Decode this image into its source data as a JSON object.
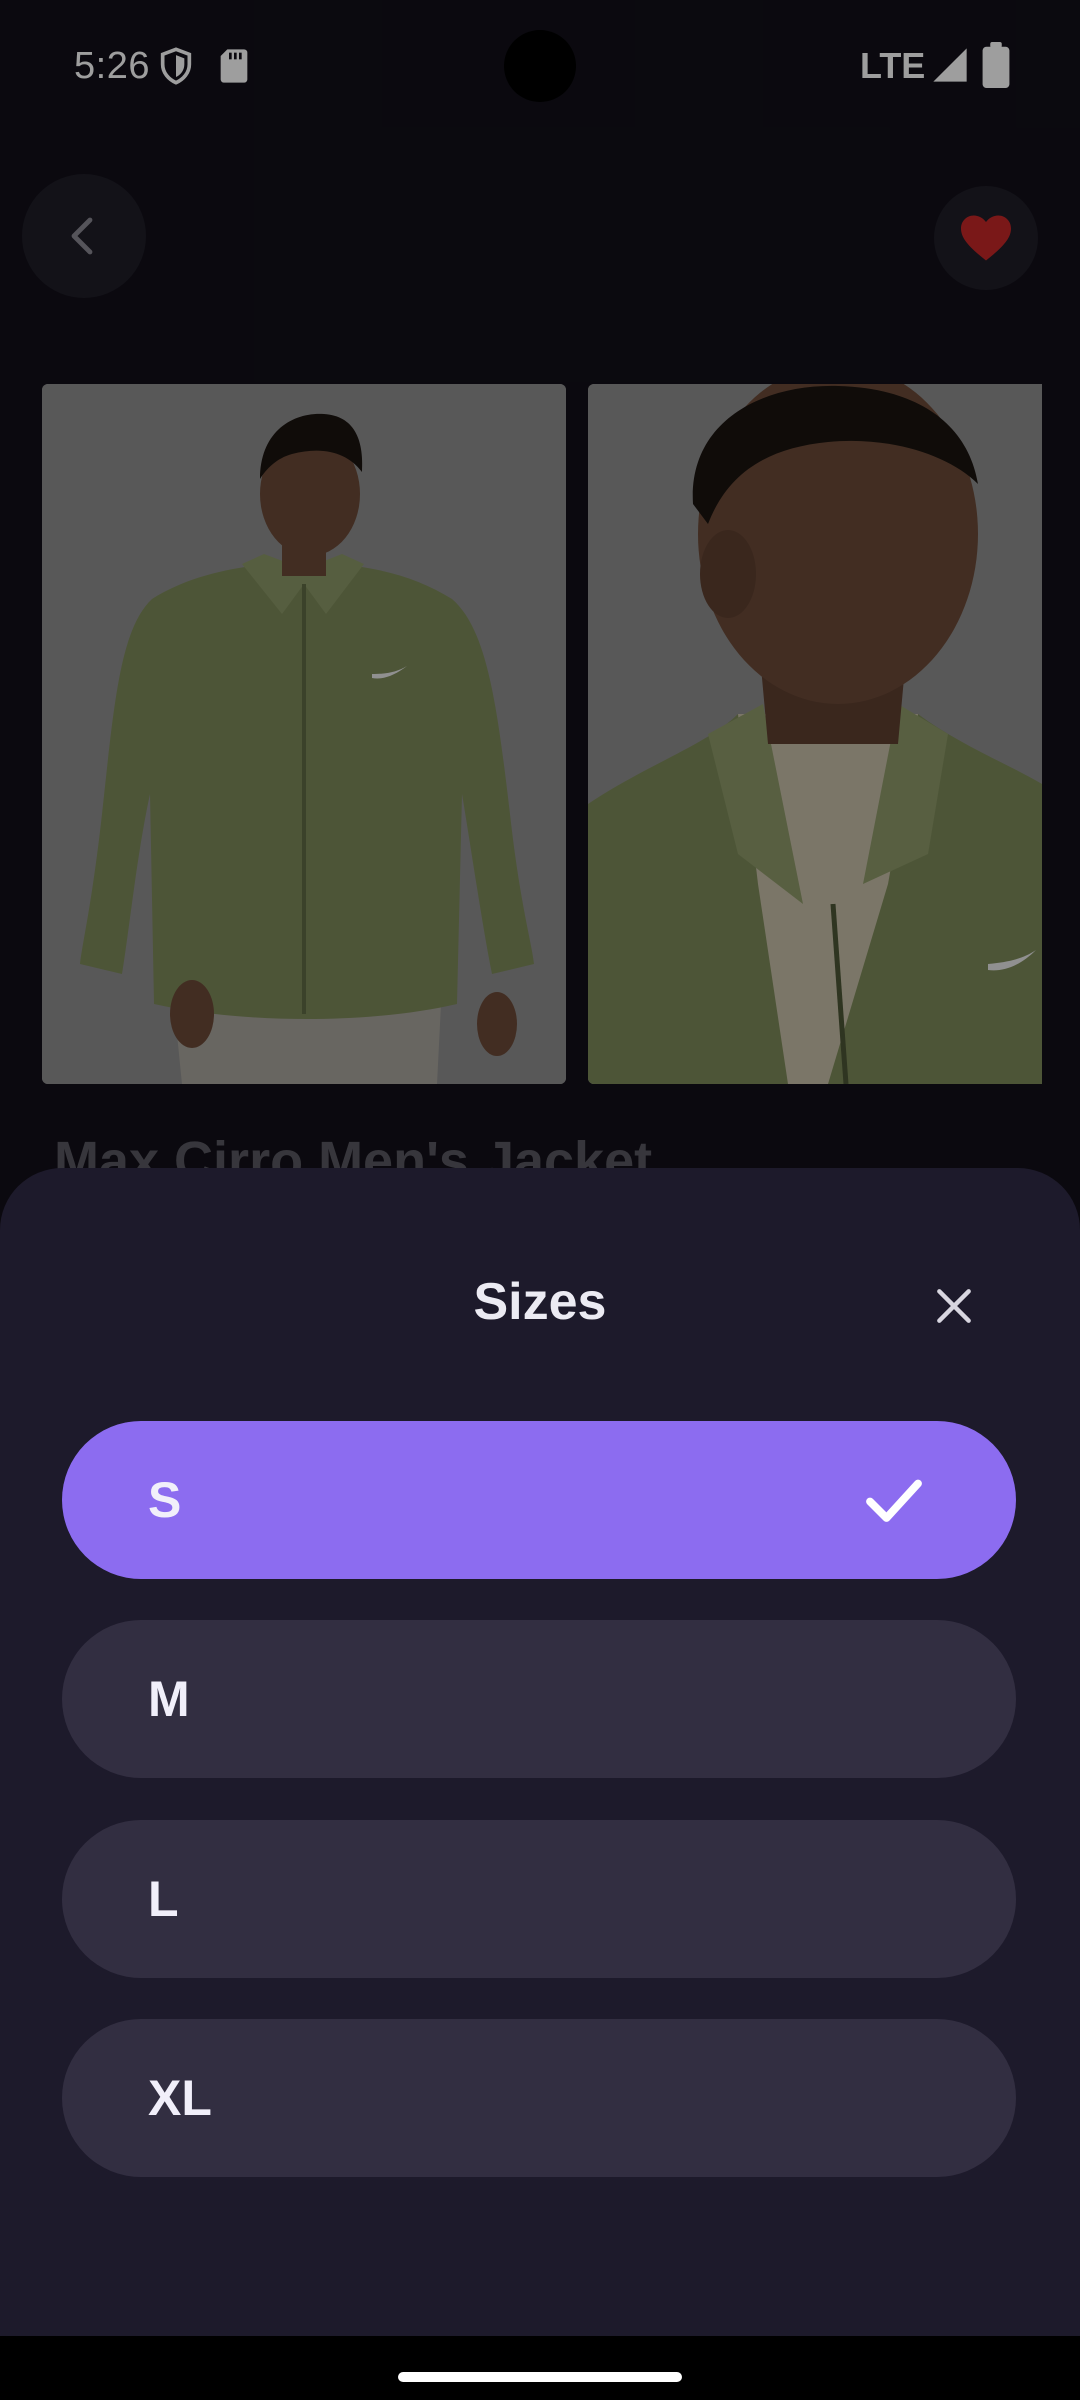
{
  "status_bar": {
    "time": "5:26",
    "network": "LTE",
    "icons": [
      "shield-icon",
      "sd-card-icon",
      "signal-icon",
      "battery-icon"
    ]
  },
  "top_bar": {
    "back_icon": "chevron-left-icon",
    "favorite_icon": "heart-icon",
    "favorite_color": "#c62828"
  },
  "product": {
    "title": "Max Cirro Men's Jacket",
    "image_colors": {
      "background": "#8f8f8f",
      "jacket": "#7d8a5a",
      "skin": "#6b4a38",
      "hair": "#1a1410"
    }
  },
  "sheet": {
    "title": "Sizes",
    "close_icon": "close-icon",
    "accent": "#8c6cf0",
    "options": [
      {
        "label": "S",
        "selected": true
      },
      {
        "label": "M",
        "selected": false
      },
      {
        "label": "L",
        "selected": false
      },
      {
        "label": "XL",
        "selected": false
      }
    ]
  }
}
